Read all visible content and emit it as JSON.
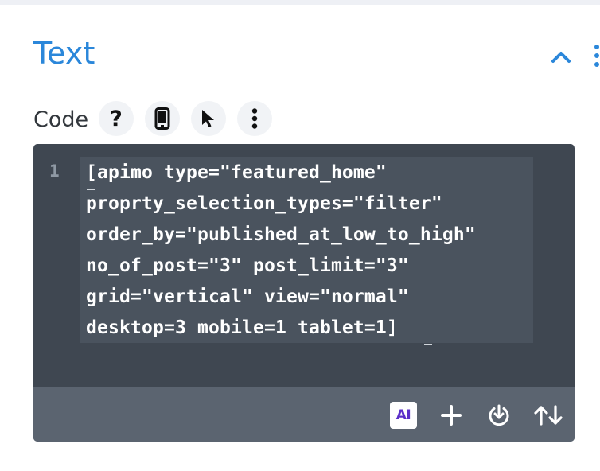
{
  "section": {
    "title": "Text"
  },
  "field": {
    "label": "Code"
  },
  "editor": {
    "line_number": "1",
    "code_lines": [
      "[apimo type=\"featured_home\"",
      "proprty_selection_types=\"filter\"",
      "order_by=\"published_at_low_to_high\"",
      "no_of_post=\"3\" post_limit=\"3\"",
      "grid=\"vertical\" view=\"normal\"",
      "desktop=3 mobile=1 tablet=1]"
    ]
  },
  "toolbar": {
    "ai_label": "AI"
  },
  "icons": {
    "collapse": "chevron-up-icon",
    "section_menu": "vertical-dots-icon",
    "help": "question-mark-icon",
    "responsive": "mobile-device-icon",
    "hover": "cursor-pointer-icon",
    "options": "vertical-dots-icon",
    "add": "plus-icon",
    "dynamic": "power-download-icon",
    "sort": "sort-arrows-icon"
  },
  "colors": {
    "accent": "#2b87da",
    "editor_bg": "#3f4751",
    "toolbar_bg": "#5b6470",
    "ai_purple": "#5b2fc9"
  }
}
